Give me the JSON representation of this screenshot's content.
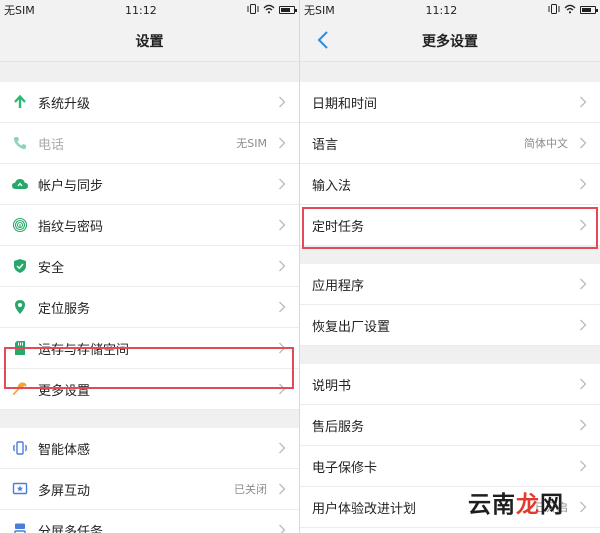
{
  "left": {
    "status": {
      "carrier": "无SIM",
      "time": "11:12"
    },
    "title": "设置",
    "group1": [
      {
        "label": "系统升级",
        "value": "",
        "icon": "arrow-up-icon",
        "color": "#2eb872"
      },
      {
        "label": "电话",
        "value": "无SIM",
        "icon": "phone-icon",
        "color": "#8fd4b6",
        "disabled": true
      },
      {
        "label": "帐户与同步",
        "value": "",
        "icon": "cloud-sync-icon",
        "color": "#27a86a"
      },
      {
        "label": "指纹与密码",
        "value": "",
        "icon": "fingerprint-icon",
        "color": "#27a86a"
      },
      {
        "label": "安全",
        "value": "",
        "icon": "shield-icon",
        "color": "#27a86a"
      },
      {
        "label": "定位服务",
        "value": "",
        "icon": "location-pin-icon",
        "color": "#27a86a"
      },
      {
        "label": "运存与存储空间",
        "value": "",
        "icon": "sd-card-icon",
        "color": "#27a86a"
      },
      {
        "label": "更多设置",
        "value": "",
        "icon": "wrench-icon",
        "color": "#f2a23a"
      }
    ],
    "group2": [
      {
        "label": "智能体感",
        "value": "",
        "icon": "motion-phone-icon",
        "color": "#4a7fd8"
      },
      {
        "label": "多屏互动",
        "value": "已关闭",
        "icon": "multi-screen-icon",
        "color": "#4a7fd8"
      },
      {
        "label": "分屏多任务",
        "value": "",
        "icon": "split-screen-icon",
        "color": "#4a7fd8"
      }
    ]
  },
  "right": {
    "status": {
      "carrier": "无SIM",
      "time": "11:12"
    },
    "title": "更多设置",
    "group1": [
      {
        "label": "日期和时间",
        "value": ""
      },
      {
        "label": "语言",
        "value": "简体中文"
      },
      {
        "label": "输入法",
        "value": ""
      },
      {
        "label": "定时任务",
        "value": ""
      }
    ],
    "group2": [
      {
        "label": "应用程序",
        "value": ""
      },
      {
        "label": "恢复出厂设置",
        "value": ""
      }
    ],
    "group3": [
      {
        "label": "说明书",
        "value": ""
      },
      {
        "label": "售后服务",
        "value": ""
      },
      {
        "label": "电子保修卡",
        "value": ""
      },
      {
        "label": "用户体验改进计划",
        "value": "已开启"
      }
    ]
  },
  "watermark": {
    "part1": "云南",
    "part2": "龙",
    "part3": "网"
  },
  "colors": {
    "highlight": "#e34a55",
    "back_arrow": "#2a8de0",
    "chevron": "#bbbbbb"
  }
}
